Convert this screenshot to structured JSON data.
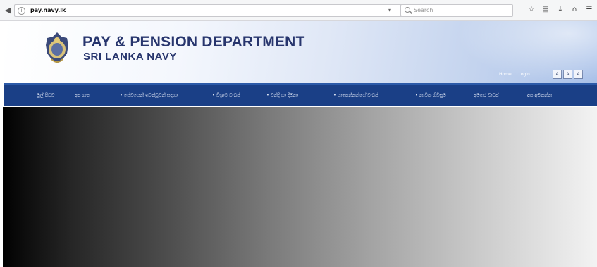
{
  "browser": {
    "url_prefix": "(i) ",
    "url_domain": "pay.navy.lk",
    "url_suffix": "",
    "search_placeholder": "Search",
    "icons": [
      "back-icon",
      "info-icon",
      "dropdown-icon",
      "search-icon",
      "star-icon",
      "reader-icon",
      "download-icon",
      "home-icon"
    ]
  },
  "header": {
    "title": "PAY & PENSION DEPARTMENT",
    "subtitle": "SRI LANKA  NAVY",
    "links": [
      "Home",
      "Login"
    ],
    "font_buttons": [
      "A",
      "A",
      "A"
    ]
  },
  "nav": {
    "items": [
      "මුල් පිටුව",
      "අප ගැන",
      "• සේවයෙන් ඉවත්වූවන් සඳහා",
      "• විශ්‍රාම වැටුප්",
      "• වන්දි හා දීමනා",
      "• යැපෙන්නන්ගේ වැටුප්",
      "• නාවික ගිවිසුම",
      "අමතර වැටුප්",
      "අප අමතන්න"
    ]
  },
  "colors": {
    "nav_bg": "#1a3f86",
    "title_color": "#27356d"
  }
}
